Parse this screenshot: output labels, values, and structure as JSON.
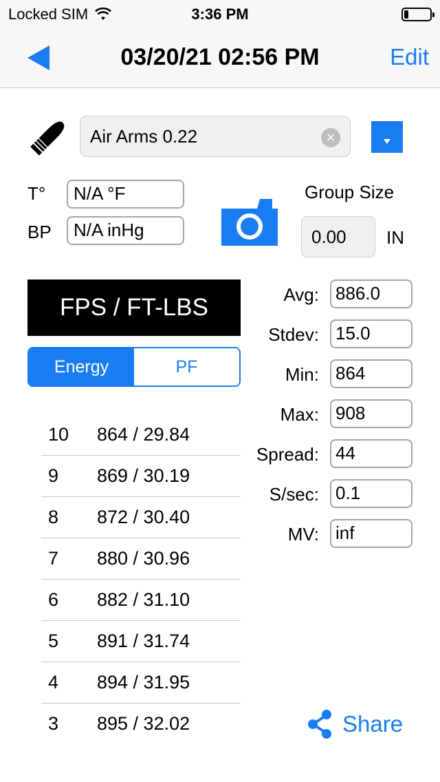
{
  "status_bar": {
    "carrier": "Locked SIM",
    "time": "3:36 PM",
    "battery_level": 0.18
  },
  "nav": {
    "title": "03/20/21 02:56 PM",
    "edit_label": "Edit"
  },
  "ammo": {
    "value": "Air Arms 0.22"
  },
  "conditions": {
    "temp_label": "T°",
    "temp_value": "N/A °F",
    "bp_label": "BP",
    "bp_value": "N/A inHg"
  },
  "group": {
    "label": "Group Size",
    "value": "0.00",
    "unit": "IN"
  },
  "units_header": "FPS / FT-LBS",
  "segmented": {
    "options": [
      "Energy",
      "PF"
    ],
    "selected": "Energy"
  },
  "shots": [
    {
      "num": "10",
      "val": "864 / 29.84"
    },
    {
      "num": "9",
      "val": "869 / 30.19"
    },
    {
      "num": "8",
      "val": "872 / 30.40"
    },
    {
      "num": "7",
      "val": "880 / 30.96"
    },
    {
      "num": "6",
      "val": "882 / 31.10"
    },
    {
      "num": "5",
      "val": "891 / 31.74"
    },
    {
      "num": "4",
      "val": "894 / 31.95"
    },
    {
      "num": "3",
      "val": "895 / 32.02"
    }
  ],
  "stats": [
    {
      "label": "Avg:",
      "value": "886.0"
    },
    {
      "label": "Stdev:",
      "value": "15.0"
    },
    {
      "label": "Min:",
      "value": "864"
    },
    {
      "label": "Max:",
      "value": "908"
    },
    {
      "label": "Spread:",
      "value": "44"
    },
    {
      "label": "S/sec:",
      "value": "0.1"
    },
    {
      "label": "MV:",
      "value": "inf"
    }
  ],
  "share_label": "Share",
  "icons": {
    "back": "back-arrow-icon",
    "ammo": "bullet-icon",
    "clear": "clear-icon",
    "dropdown": "dropdown-icon",
    "camera": "camera-icon",
    "share": "share-icon",
    "wifi": "wifi-icon",
    "battery": "battery-icon"
  },
  "colors": {
    "accent": "#1a7cf2",
    "header_bg": "#000000"
  }
}
